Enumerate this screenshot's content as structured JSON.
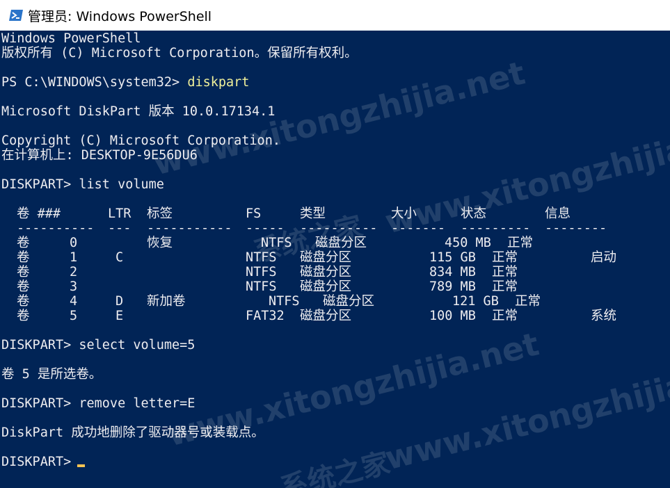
{
  "window": {
    "title": "管理员: Windows PowerShell",
    "icon": "powershell-icon"
  },
  "console": {
    "lines": [
      "Windows PowerShell",
      "版权所有 (C) Microsoft Corporation。保留所有权利。",
      "",
      "PS C:\\WINDOWS\\system32> ",
      "",
      "Microsoft DiskPart 版本 10.0.17134.1",
      "",
      "Copyright (C) Microsoft Corporation.",
      "在计算机上: DESKTOP-9E56DU6",
      "",
      "DISKPART> list volume"
    ],
    "ps_command": "diskpart",
    "after_table": [
      "DISKPART> select volume=5",
      "",
      "卷 5 是所选卷。",
      "",
      "DISKPART> remove letter=E",
      "",
      "DiskPart 成功地删除了驱动器号或装载点。",
      "",
      "DISKPART> "
    ]
  },
  "volume_table": {
    "headers": [
      "卷 ###",
      "LTR",
      "标签",
      "FS",
      "类型",
      "大小",
      "状态",
      "信息"
    ],
    "dashes": [
      "----------",
      "---",
      "-----------",
      "-----",
      "----------",
      "-------",
      "---------",
      "--------"
    ],
    "rows": [
      [
        "卷",
        "0",
        "",
        "恢复",
        "NTFS",
        "磁盘分区",
        "450 MB",
        "正常",
        ""
      ],
      [
        "卷",
        "1",
        "C",
        "",
        "NTFS",
        "磁盘分区",
        "115 GB",
        "正常",
        "启动"
      ],
      [
        "卷",
        "2",
        "",
        "",
        "NTFS",
        "磁盘分区",
        "834 MB",
        "正常",
        ""
      ],
      [
        "卷",
        "3",
        "",
        "",
        "NTFS",
        "磁盘分区",
        "789 MB",
        "正常",
        ""
      ],
      [
        "卷",
        "4",
        "D",
        "新加卷",
        "NTFS",
        "磁盘分区",
        "121 GB",
        "正常",
        ""
      ],
      [
        "卷",
        "5",
        "E",
        "",
        "FAT32",
        "磁盘分区",
        "100 MB",
        "正常",
        "系统"
      ]
    ]
  },
  "watermark": {
    "url": "www.xitongzhijia.net",
    "brand": "系统之家"
  },
  "colors": {
    "background": "#012456",
    "text": "#eeedf0",
    "command": "#f0f09a",
    "cursor": "#f6c453"
  }
}
